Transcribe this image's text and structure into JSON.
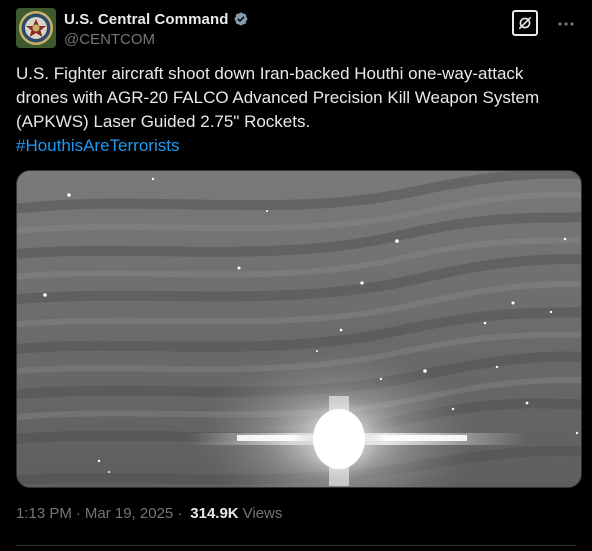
{
  "author": {
    "display_name": "U.S. Central Command",
    "handle": "@CENTCOM",
    "verified": true,
    "avatar_icon": "centcom-seal-icon",
    "verified_color": "#829aab"
  },
  "tweet": {
    "text": "U.S. Fighter aircraft shoot down Iran-backed Houthi one-way-attack drones with AGR-20 FALCO Advanced Precision Kill Weapon System (APKWS) Laser Guided 2.75\" Rockets.",
    "hashtag": "#HouthisAreTerrorists",
    "hashtag_color": "#1d9bf0"
  },
  "media": {
    "type": "image",
    "icon": "night-sky-explosion-image"
  },
  "meta": {
    "time": "1:13 PM",
    "separator": "·",
    "date": "Mar 19, 2025",
    "views_count": "314.9K",
    "views_label": "Views"
  },
  "actions": {
    "grok_icon": "grok-icon",
    "more_icon": "more-icon"
  }
}
